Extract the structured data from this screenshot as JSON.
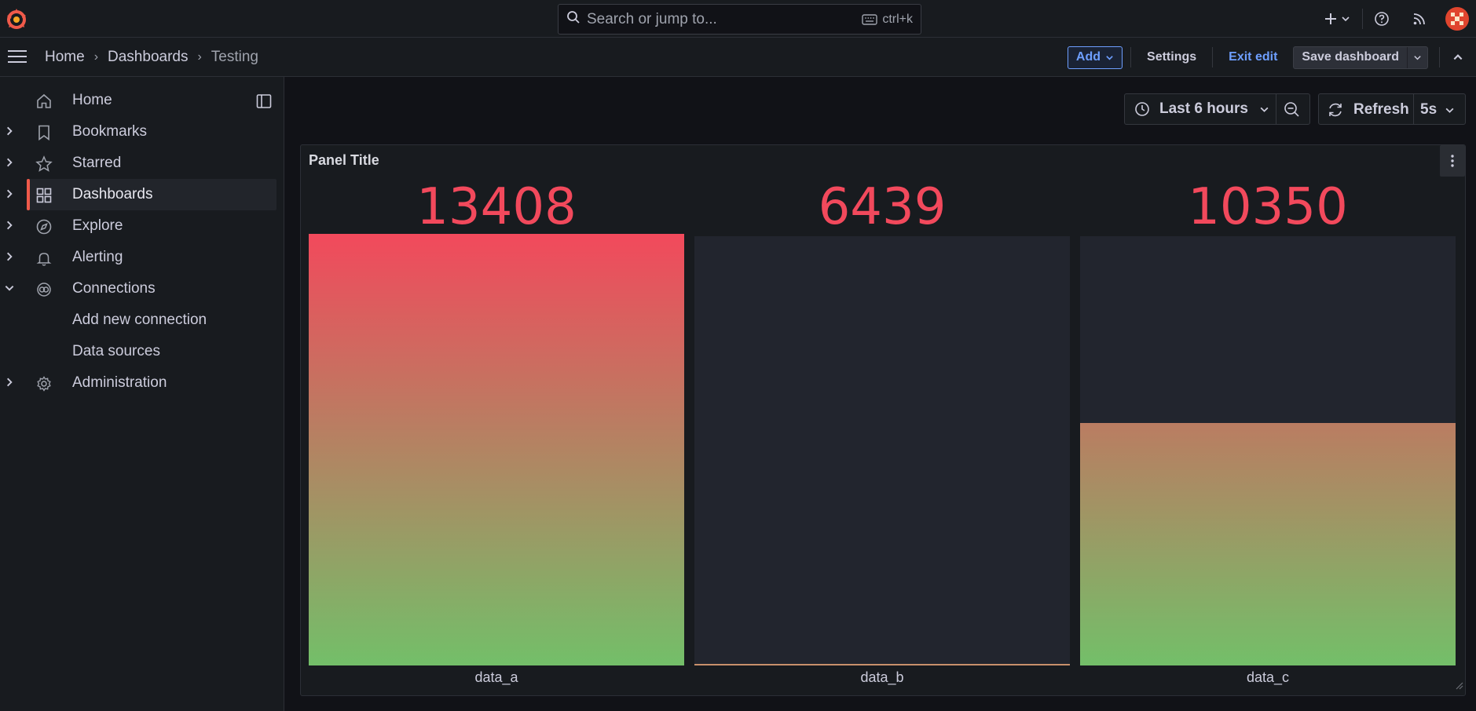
{
  "topbar": {
    "search_placeholder": "Search or jump to...",
    "search_shortcut": "ctrl+k"
  },
  "breadcrumbs": [
    "Home",
    "Dashboards",
    "Testing"
  ],
  "toolbar": {
    "add_label": "Add",
    "settings_label": "Settings",
    "exit_edit_label": "Exit edit",
    "save_label": "Save dashboard"
  },
  "sidebar": {
    "items": [
      {
        "label": "Home",
        "icon": "home-icon",
        "expandable": false
      },
      {
        "label": "Bookmarks",
        "icon": "bookmark-icon",
        "expandable": true
      },
      {
        "label": "Starred",
        "icon": "star-icon",
        "expandable": true
      },
      {
        "label": "Dashboards",
        "icon": "apps-icon",
        "expandable": true,
        "active": true
      },
      {
        "label": "Explore",
        "icon": "compass-icon",
        "expandable": true
      },
      {
        "label": "Alerting",
        "icon": "bell-icon",
        "expandable": true
      },
      {
        "label": "Connections",
        "icon": "connections-icon",
        "expandable": true,
        "expanded": true
      },
      {
        "label": "Add new connection",
        "sub": true
      },
      {
        "label": "Data sources",
        "sub": true
      },
      {
        "label": "Administration",
        "icon": "cog-icon",
        "expandable": true
      }
    ]
  },
  "time_controls": {
    "range_label": "Last 6 hours",
    "refresh_label": "Refresh",
    "interval_label": "5s"
  },
  "panel": {
    "title": "Panel Title",
    "gauges": [
      {
        "name": "data_a",
        "value": "13408",
        "fill": 1.0
      },
      {
        "name": "data_b",
        "value": "6439",
        "fill": 0.0
      },
      {
        "name": "data_c",
        "value": "10350",
        "fill": 0.565
      }
    ]
  },
  "colors": {
    "accent": "#f05a4a",
    "value_red": "#f2495c",
    "gradient_low": "#73bf69",
    "link_blue": "#6e9fff"
  }
}
